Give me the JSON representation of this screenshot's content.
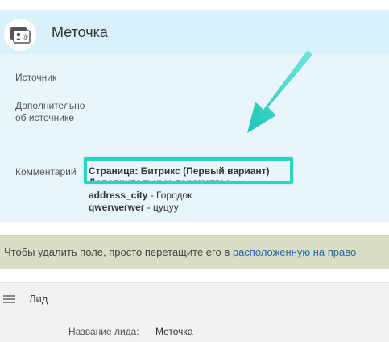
{
  "card": {
    "title": "Меточка",
    "avatar_icon": "contact-card-icon"
  },
  "fields": {
    "source_label": "Источник",
    "extra_label": "Дополнительно об источнике",
    "comment_label": "Комментарий"
  },
  "comment": {
    "line1": "Страница: Битрикс (Первый вариант)",
    "line2": "Дополнительные параметры:",
    "city_key": "address_city",
    "city_value": " - Городок",
    "qwer_key": "qwerwerwer",
    "qwer_value": " - цуцуу"
  },
  "annotation": {
    "highlight_color": "#2fd1c4",
    "arrow_color": "#2fd1c4"
  },
  "hint": {
    "text": "Чтобы удалить поле, просто перетащите его в ",
    "link": "расположенную на право"
  },
  "section": {
    "title": "Лид",
    "handle_icon": "drag-handle-icon"
  },
  "lead": {
    "name_label": "Название лида:",
    "name_value": "Меточка"
  }
}
